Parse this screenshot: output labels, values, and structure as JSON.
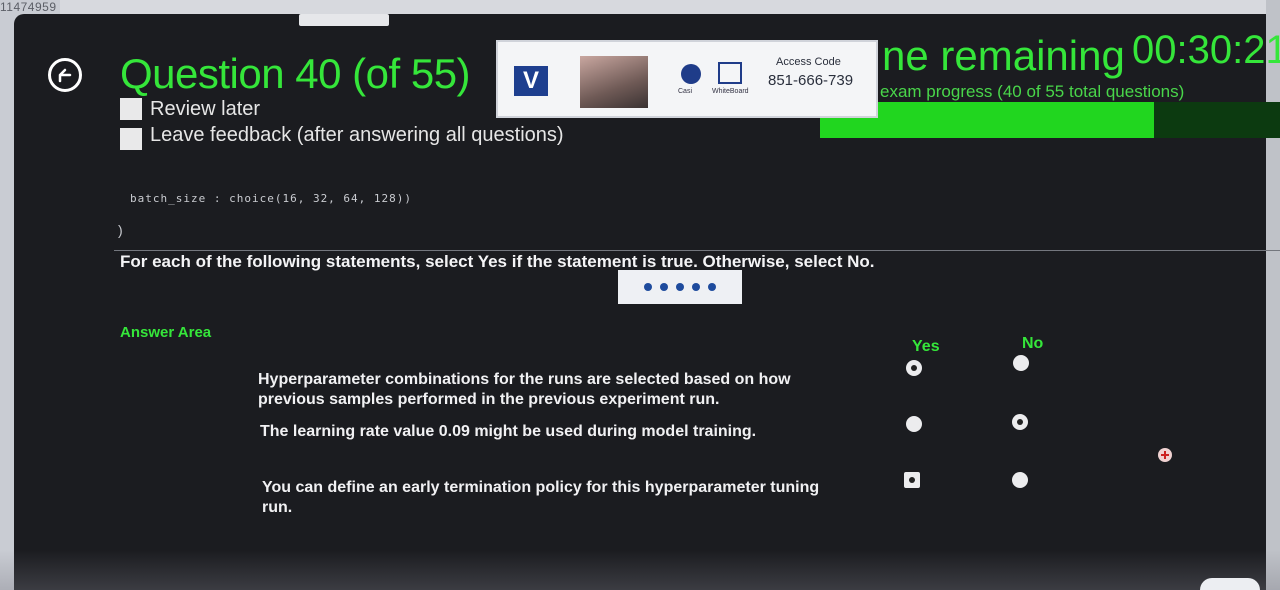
{
  "window": {
    "id_text": "11474959"
  },
  "header": {
    "title": "Question 40 (of 55)",
    "time_label": "ne remaining",
    "time_value": "00:30:21",
    "progress_label": "exam progress (40 of 55 total questions)",
    "progress_fraction": 0.727
  },
  "proctor": {
    "logo_letter": "V",
    "chat_label": "Casi",
    "whiteboard_label": "WhiteBoard",
    "access_label": "Access Code",
    "access_code": "851-666-739"
  },
  "options": {
    "review_later": "Review later",
    "leave_feedback": "Leave feedback (after answering all questions)"
  },
  "question": {
    "code_fragment": "batch_size : choice(16, 32, 64, 128))",
    "code_close": ")",
    "instruction": "For each of the following statements, select Yes if the statement is true. Otherwise, select No.",
    "answer_area": "Answer Area",
    "col_yes": "Yes",
    "col_no": "No",
    "statements": [
      {
        "text": "Hyperparameter combinations for the runs are selected based on how previous samples performed in the previous experiment run.",
        "selected": "Yes"
      },
      {
        "text": "The learning rate value 0.09 might be used during model training.",
        "selected": "No"
      },
      {
        "text": "You can define an early termination policy for this hyperparameter tuning run.",
        "selected": "Yes"
      }
    ]
  }
}
